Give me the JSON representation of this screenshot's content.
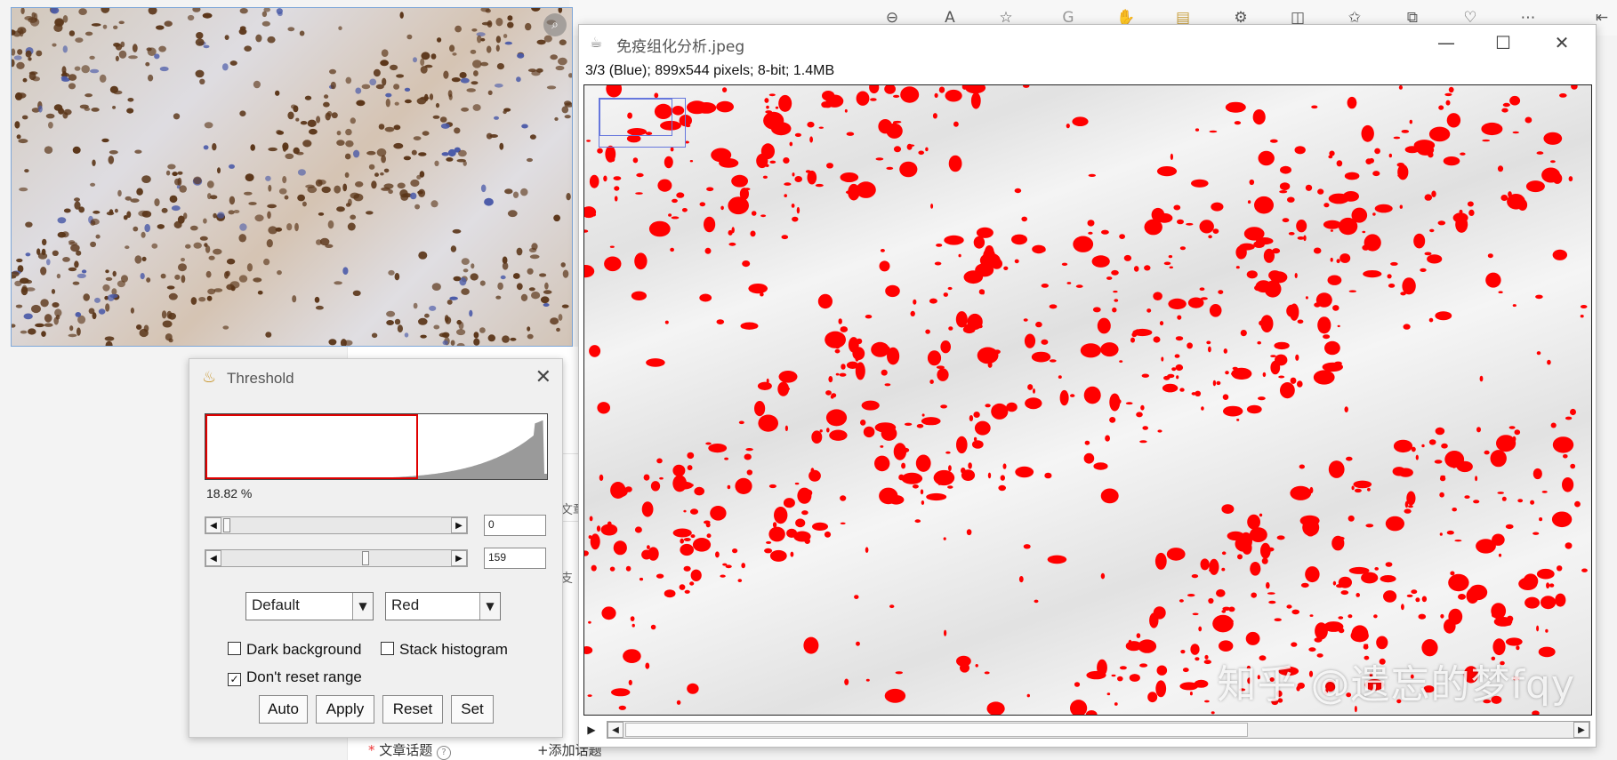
{
  "browser_toolbar": {
    "icons": [
      "zoom-out-icon",
      "read-aloud-icon",
      "favorite-star-icon",
      "g-extension-icon",
      "extension-blue-icon",
      "extension-note-icon",
      "extensions-puzzle-icon",
      "split-screen-icon",
      "favorites-icon",
      "collections-icon",
      "health-icon",
      "more-icon",
      "sidebar-icon"
    ]
  },
  "background_page": {
    "frag_1": "文章",
    "frag_2": "支",
    "topic_label": "文章话题",
    "add_topic": "添加话题"
  },
  "threshold": {
    "title": "Threshold",
    "percent": "18.82 %",
    "min_value": "0",
    "max_value": "159",
    "method": "Default",
    "display": "Red",
    "dark_background": "Dark background",
    "stack_histogram": "Stack histogram",
    "dont_reset": "Don't reset range",
    "dark_background_checked": false,
    "stack_histogram_checked": false,
    "dont_reset_checked": true,
    "buttons": {
      "auto": "Auto",
      "apply": "Apply",
      "reset": "Reset",
      "set": "Set"
    },
    "threshold_low": 0,
    "threshold_high": 159
  },
  "image_window": {
    "title": "免疫组化分析.jpeg",
    "info": "3/3 (Blue); 899x544 pixels; 8-bit; 1.4MB",
    "watermark": "知乎 @遗忘的梦fqy",
    "overlay_color": "#ff0000"
  },
  "colors": {
    "threshold_red": "#ff0000",
    "hematoxylin_blue": "#4a5aa8",
    "dab_brown": "#5a3518"
  }
}
